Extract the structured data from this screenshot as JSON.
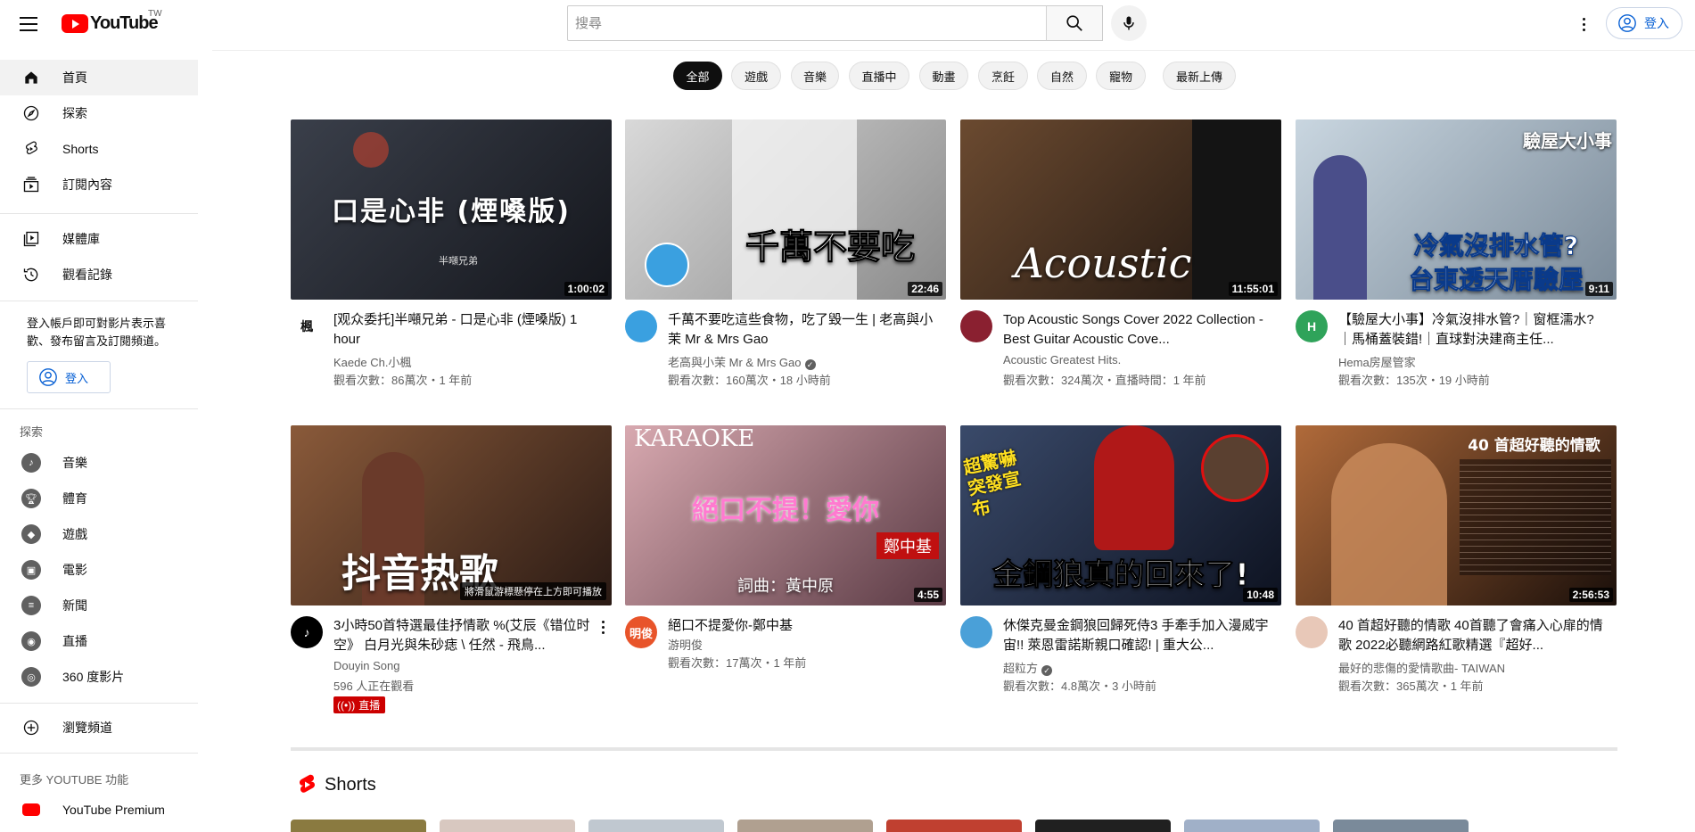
{
  "masthead": {
    "logo_text": "YouTube",
    "country": "TW",
    "search_placeholder": "搜尋",
    "signin_label": "登入"
  },
  "sidebar": {
    "main": [
      {
        "label": "首頁",
        "icon": "home-icon"
      },
      {
        "label": "探索",
        "icon": "compass-icon"
      },
      {
        "label": "Shorts",
        "icon": "shorts-icon"
      },
      {
        "label": "訂閱內容",
        "icon": "subscriptions-icon"
      }
    ],
    "library": [
      {
        "label": "媒體庫",
        "icon": "library-icon"
      },
      {
        "label": "觀看記錄",
        "icon": "history-icon"
      }
    ],
    "signin_note": "登入帳戶即可對影片表示喜歡、發布留言及訂閱頻道。",
    "signin_label": "登入",
    "explore_title": "探索",
    "explore": [
      {
        "label": "音樂",
        "icon": "music-icon"
      },
      {
        "label": "體育",
        "icon": "trophy-icon"
      },
      {
        "label": "遊戲",
        "icon": "gaming-icon"
      },
      {
        "label": "電影",
        "icon": "movie-icon"
      },
      {
        "label": "新聞",
        "icon": "news-icon"
      },
      {
        "label": "直播",
        "icon": "live-icon"
      },
      {
        "label": "360 度影片",
        "icon": "vr-icon"
      }
    ],
    "browse_channels": "瀏覽頻道",
    "more_title": "更多 YOUTUBE 功能",
    "premium": "YouTube Premium"
  },
  "chips": [
    "全部",
    "遊戲",
    "音樂",
    "直播中",
    "動畫",
    "烹飪",
    "自然",
    "寵物",
    "最新上傳"
  ],
  "videos": [
    {
      "title": "[观众委托]半噸兄弟 - 口是心非 (煙嗓版) 1 hour",
      "channel": "Kaede Ch.小楓",
      "stats": "觀看次數：86萬次・1 年前",
      "duration": "1:00:02",
      "thumb_text": "口是心非 (煙嗓版)",
      "thumb_sub": "半噸兄弟",
      "avatar_text": "楓",
      "colors": {
        "thumb_a": "#3a3f4a",
        "thumb_b": "#14161c",
        "avatar": "#ffffff",
        "avatar_fg": "#111111"
      }
    },
    {
      "title": "千萬不要吃這些食物，吃了毀一生 | 老高與小茉 Mr & Mrs Gao",
      "channel": "老高與小茉 Mr & Mrs Gao",
      "verified": "✓",
      "stats": "觀看次數：160萬次・18 小時前",
      "duration": "22:46",
      "thumb_text": "千萬不要吃",
      "avatar_text": "",
      "colors": {
        "thumb_a": "#d9d9d9",
        "thumb_b": "#8a8a8a",
        "avatar": "#3aa0e0",
        "avatar_fg": "#ffffff"
      }
    },
    {
      "title": "Top Acoustic Songs Cover 2022 Collection - Best Guitar Acoustic Cove...",
      "channel": "Acoustic Greatest Hits.",
      "stats": "觀看次數：324萬次・直播時間：1 年前",
      "duration": "11:55:01",
      "thumb_text": "Acoustic",
      "avatar_text": "",
      "colors": {
        "thumb_a": "#6b4a30",
        "thumb_b": "#1e1510",
        "avatar": "#8a2030",
        "avatar_fg": "#ffffff"
      }
    },
    {
      "title": "【驗屋大小事】冷氣沒排水管?｜窗框濡水?｜馬桶蓋裝錯!｜直球對決建商主任...",
      "channel": "Hema房屋管家",
      "stats": "觀看次數：135次・19 小時前",
      "duration": "9:11",
      "thumb_text": "冷氣沒排水管?",
      "thumb_sub": "台東透天厝驗屋",
      "thumb_corner": "驗屋大小事",
      "avatar_text": "H",
      "colors": {
        "thumb_a": "#c9d6e0",
        "thumb_b": "#7a8a99",
        "avatar": "#2fa35a",
        "avatar_fg": "#ffffff"
      }
    },
    {
      "title": "3小時50首特選最佳抒情歌 %(艾辰《错位时空》 白月光與朱砂痣 \\ 任然 - 飛鳥...",
      "channel": "Douyin Song",
      "stats": "596 人正在觀看",
      "live": "直播",
      "thumb_text": "抖音热歌",
      "thumb_note": "將滑鼠游標懸停在上方即可播放",
      "avatar_text": "♪",
      "colors": {
        "thumb_a": "#8a5a3a",
        "thumb_b": "#2a1a14",
        "avatar": "#000000",
        "avatar_fg": "#ffffff"
      }
    },
    {
      "title": "絕口不提愛你-鄭中基",
      "channel": "游明俊",
      "stats": "觀看次數：17萬次・1 年前",
      "duration": "4:55",
      "thumb_text": "絕口不提！愛你",
      "thumb_sub": "詞曲：黃中原",
      "thumb_corner": "KARAOKE",
      "thumb_tag": "鄭中基",
      "avatar_text": "明俊",
      "colors": {
        "thumb_a": "#d8a9b0",
        "thumb_b": "#5a3a44",
        "avatar": "#e8542a",
        "avatar_fg": "#ffffff"
      }
    },
    {
      "title": "休傑克曼金鋼狼回歸死侍3 手牽手加入漫威宇宙!! 萊恩雷諾斯親口確認! | 重大公...",
      "channel": "超粒方",
      "verified": "✓",
      "stats": "觀看次數：4.8萬次・3 小時前",
      "duration": "10:48",
      "thumb_text": "金鋼狼真的回來了!",
      "thumb_corner": "超驚嚇 突發宣布",
      "avatar_text": "",
      "colors": {
        "thumb_a": "#3a4a6a",
        "thumb_b": "#0d1220",
        "avatar": "#4aa0d8",
        "avatar_fg": "#ffffff"
      }
    },
    {
      "title": "40 首超好聽的情歌 40首聽了會痛入心扉的情歌 2022必聽網路紅歌精選『超好...",
      "channel": "最好的悲傷的愛情歌曲- TAIWAN",
      "stats": "觀看次數：365萬次・1 年前",
      "duration": "2:56:53",
      "thumb_text": "40 首超好聽的情歌",
      "avatar_text": "",
      "colors": {
        "thumb_a": "#b06a3a",
        "thumb_b": "#1a0f0a",
        "avatar": "#e8c8b8",
        "avatar_fg": "#ffffff"
      }
    }
  ],
  "shorts": {
    "title": "Shorts",
    "colors": [
      "#8a7a40",
      "#d8c8c0",
      "#c0c8d0",
      "#b0a090",
      "#c04030",
      "#202020",
      "#a0b0c8",
      "#7a8a9a"
    ]
  },
  "colors": {
    "brand_red": "#ff0000",
    "link_blue": "#065fd4"
  }
}
